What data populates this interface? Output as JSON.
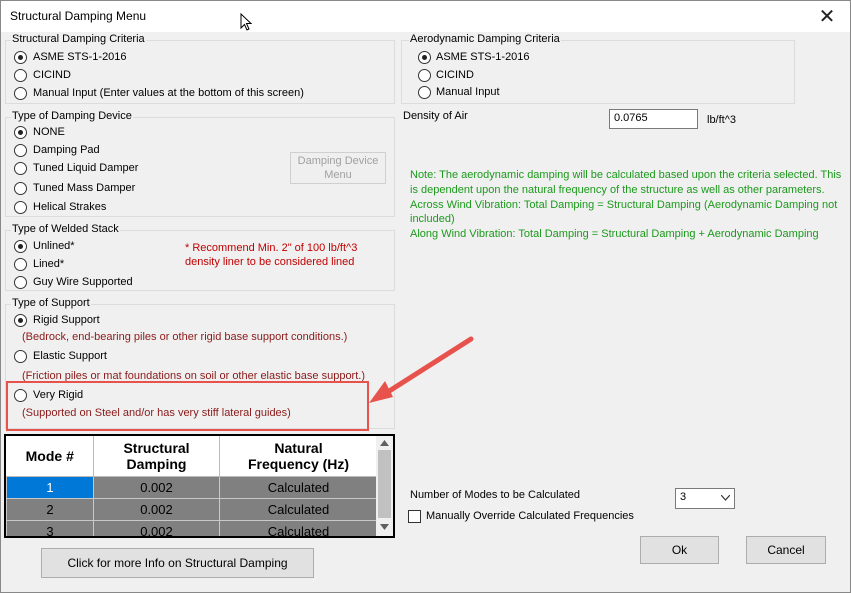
{
  "window": {
    "title": "Structural Damping Menu",
    "close": "✕"
  },
  "structural_criteria": {
    "legend": "Structural Damping Criteria",
    "options": [
      "ASME STS-1-2016",
      "CICIND",
      "Manual Input (Enter values at the bottom of this screen)"
    ],
    "selected": 0
  },
  "aero_criteria": {
    "legend": "Aerodynamic Damping Criteria",
    "options": [
      "ASME STS-1-2016",
      "CICIND",
      "Manual Input"
    ],
    "selected": 0
  },
  "damping_device": {
    "legend": "Type of Damping Device",
    "options": [
      "NONE",
      "Damping Pad",
      "Tuned Liquid Damper",
      "Tuned Mass Damper",
      "Helical Strakes"
    ],
    "selected": 0,
    "menu_button_line1": "Damping Device",
    "menu_button_line2": "Menu"
  },
  "welded_stack": {
    "legend": "Type of Welded Stack",
    "options": [
      "Unlined*",
      "Lined*",
      "Guy Wire Supported"
    ],
    "selected": 0,
    "note_line1": "* Recommend Min. 2\" of 100 lb/ft^3",
    "note_line2": "density liner to be considered lined"
  },
  "support": {
    "legend": "Type of Support",
    "options": [
      "Rigid Support",
      "Elastic Support",
      "Very Rigid"
    ],
    "descriptions": [
      "(Bedrock, end-bearing piles or other rigid base support conditions.)",
      "(Friction piles or mat foundations on soil or other elastic base support.)",
      "(Supported on Steel and/or has very stiff lateral guides)"
    ],
    "selected": 0
  },
  "air": {
    "label": "Density of Air",
    "value": "0.0765",
    "unit": "lb/ft^3"
  },
  "note": {
    "line1": "Note: The aerodynamic damping will be calculated based upon the criteria selected.  This",
    "line2": "is dependent upon the natural frequency of the structure as well as other parameters.",
    "line3": "Across Wind Vibration:  Total Damping = Structural Damping (Aerodynamic Damping not",
    "line4": "included)",
    "line5": "Along Wind Vibration:   Total Damping = Structural Damping + Aerodynamic Damping"
  },
  "grid": {
    "headers": {
      "mode": "Mode #",
      "damping1": "Structural",
      "damping2": "Damping",
      "freq1": "Natural",
      "freq2": "Frequency (Hz)"
    },
    "rows": [
      {
        "mode": "1",
        "damping": "0.002",
        "freq": "Calculated"
      },
      {
        "mode": "2",
        "damping": "0.002",
        "freq": "Calculated"
      },
      {
        "mode": "3",
        "damping": "0.002",
        "freq": "Calculated"
      }
    ]
  },
  "modes": {
    "label": "Number of Modes to be Calculated",
    "value": "3"
  },
  "override": {
    "label": "Manually Override Calculated Frequencies"
  },
  "buttons": {
    "info": "Click for more Info on Structural Damping",
    "ok": "Ok",
    "cancel": "Cancel"
  },
  "colors": {
    "note_green": "#1c9a1c",
    "warn_red": "#c00000",
    "highlight": "#e8524d",
    "selected_cell": "#0078d7"
  }
}
